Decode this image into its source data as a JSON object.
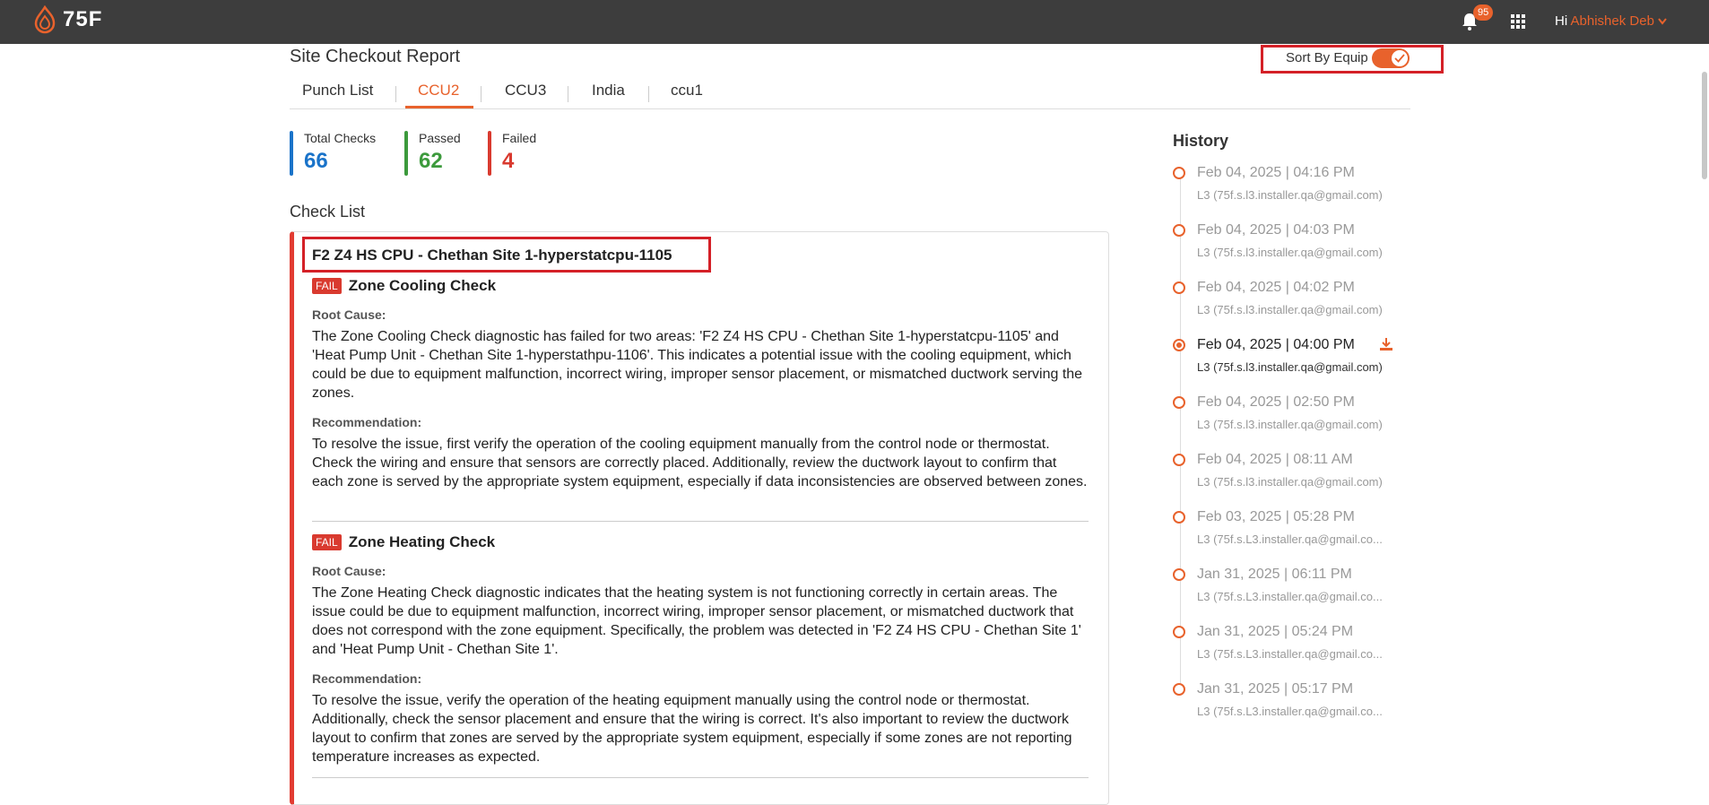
{
  "header": {
    "logo_text": "75F",
    "notification_count": "95",
    "greeting": "Hi",
    "user_name": "Abhishek Deb"
  },
  "page": {
    "title": "Site Checkout Report",
    "sort_label": "Sort By Equip",
    "sort_enabled": true
  },
  "tabs": [
    {
      "label": "Punch List",
      "active": false
    },
    {
      "label": "CCU2",
      "active": true
    },
    {
      "label": "CCU3",
      "active": false
    },
    {
      "label": "India",
      "active": false
    },
    {
      "label": "ccu1",
      "active": false
    }
  ],
  "stats": {
    "total": {
      "label": "Total Checks",
      "value": "66",
      "color": "#1a73c9"
    },
    "passed": {
      "label": "Passed",
      "value": "62",
      "color": "#3c9a3c"
    },
    "failed": {
      "label": "Failed",
      "value": "4",
      "color": "#d93a2f"
    }
  },
  "checklist": {
    "title": "Check List",
    "equip_name": "F2 Z4 HS CPU - Chethan Site 1-hyperstatcpu-1105",
    "checks": [
      {
        "status": "FAIL",
        "name": "Zone Cooling Check",
        "root_cause_label": "Root Cause:",
        "root_cause": "The Zone Cooling Check diagnostic has failed for two areas: 'F2 Z4 HS CPU - Chethan Site 1-hyperstatcpu-1105' and 'Heat Pump Unit - Chethan Site 1-hyperstathpu-1106'. This indicates a potential issue with the cooling equipment, which could be due to equipment malfunction, incorrect wiring, improper sensor placement, or mismatched ductwork serving the zones.",
        "recommendation_label": "Recommendation:",
        "recommendation": "To resolve the issue, first verify the operation of the cooling equipment manually from the control node or thermostat. Check the wiring and ensure that sensors are correctly placed. Additionally, review the ductwork layout to confirm that each zone is served by the appropriate system equipment, especially if data inconsistencies are observed between zones."
      },
      {
        "status": "FAIL",
        "name": "Zone Heating Check",
        "root_cause_label": "Root Cause:",
        "root_cause": "The Zone Heating Check diagnostic indicates that the heating system is not functioning correctly in certain areas. The issue could be due to equipment malfunction, incorrect wiring, improper sensor placement, or mismatched ductwork that does not correspond with the zone equipment. Specifically, the problem was detected in 'F2 Z4 HS CPU - Chethan Site 1' and 'Heat Pump Unit - Chethan Site 1'.",
        "recommendation_label": "Recommendation:",
        "recommendation": "To resolve the issue, verify the operation of the heating equipment manually using the control node or thermostat. Additionally, check the sensor placement and ensure that the wiring is correct. It's also important to review the ductwork layout to confirm that zones are served by the appropriate system equipment, especially if some zones are not reporting temperature increases as expected."
      }
    ]
  },
  "history": {
    "title": "History",
    "items": [
      {
        "date": "Feb 04, 2025 | 04:16 PM",
        "user": "L3 (75f.s.l3.installer.qa@gmail.com)",
        "active": false
      },
      {
        "date": "Feb 04, 2025 | 04:03 PM",
        "user": "L3 (75f.s.l3.installer.qa@gmail.com)",
        "active": false
      },
      {
        "date": "Feb 04, 2025 | 04:02 PM",
        "user": "L3 (75f.s.l3.installer.qa@gmail.com)",
        "active": false
      },
      {
        "date": "Feb 04, 2025 | 04:00 PM",
        "user": "L3 (75f.s.l3.installer.qa@gmail.com)",
        "active": true
      },
      {
        "date": "Feb 04, 2025 | 02:50 PM",
        "user": "L3 (75f.s.l3.installer.qa@gmail.com)",
        "active": false
      },
      {
        "date": "Feb 04, 2025 | 08:11 AM",
        "user": "L3 (75f.s.l3.installer.qa@gmail.com)",
        "active": false
      },
      {
        "date": "Feb 03, 2025 | 05:28 PM",
        "user": "L3 (75f.s.L3.installer.qa@gmail.co...",
        "active": false
      },
      {
        "date": "Jan 31, 2025 | 06:11 PM",
        "user": "L3 (75f.s.L3.installer.qa@gmail.co...",
        "active": false
      },
      {
        "date": "Jan 31, 2025 | 05:24 PM",
        "user": "L3 (75f.s.L3.installer.qa@gmail.co...",
        "active": false
      },
      {
        "date": "Jan 31, 2025 | 05:17 PM",
        "user": "L3 (75f.s.L3.installer.qa@gmail.co...",
        "active": false
      }
    ]
  }
}
